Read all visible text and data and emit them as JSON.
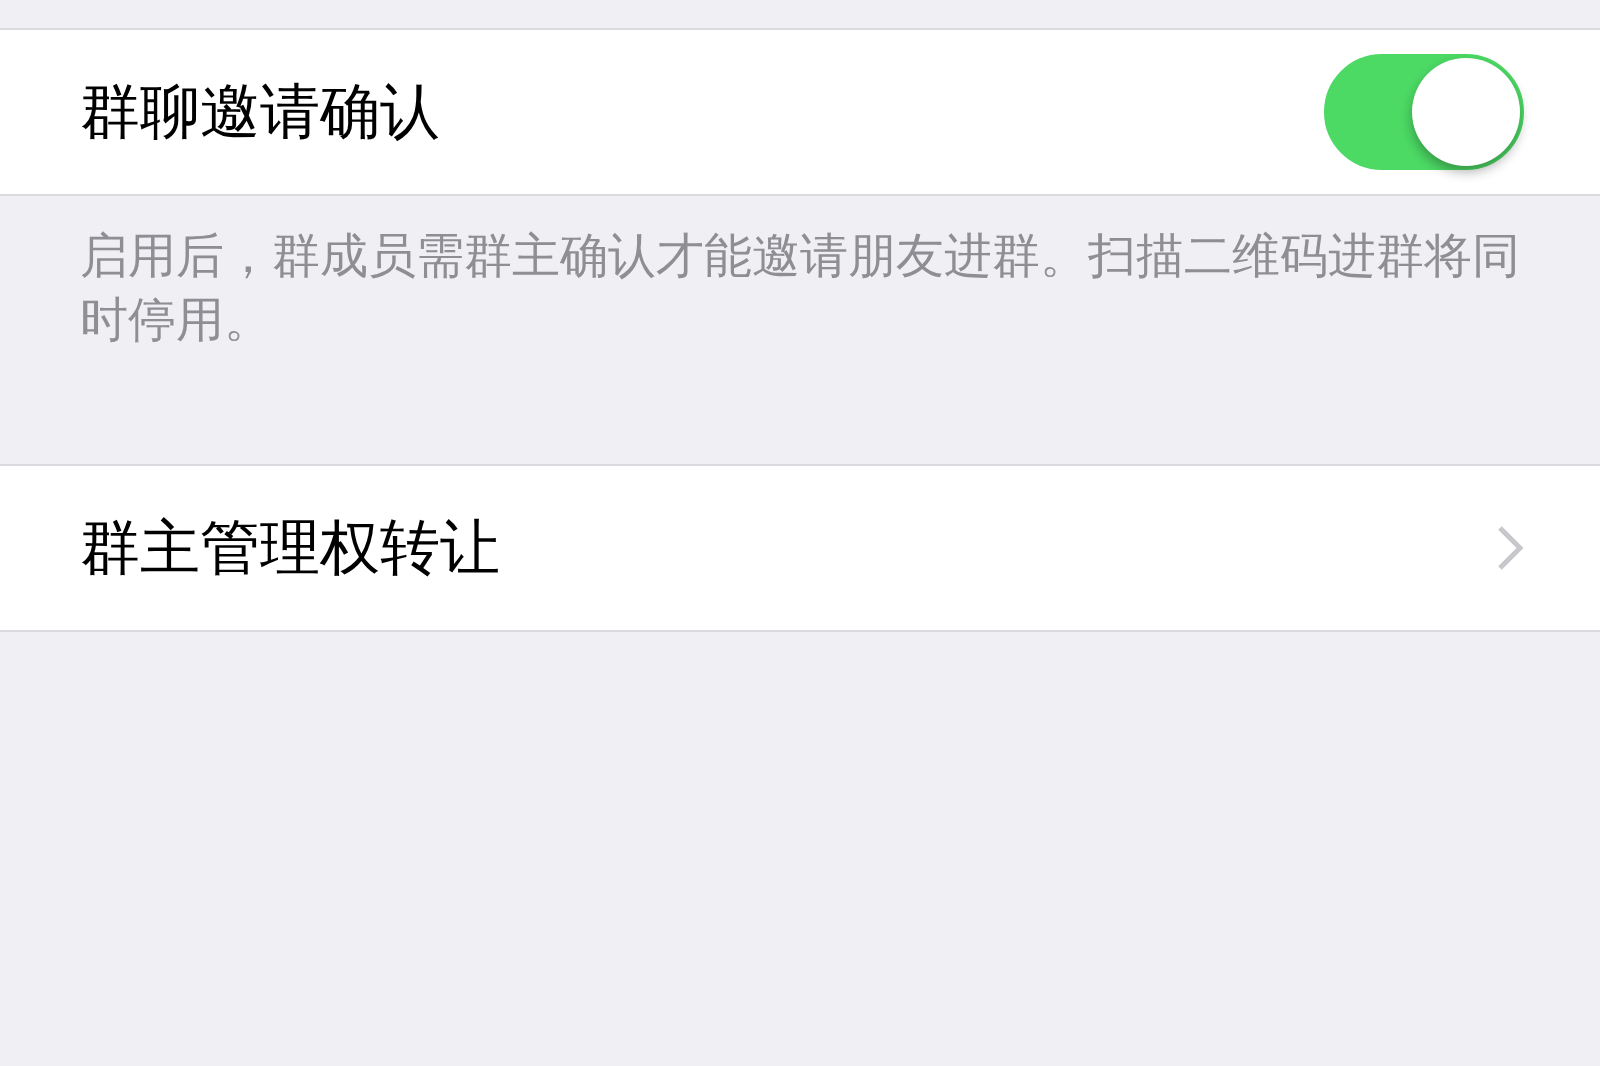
{
  "sections": [
    {
      "rows": [
        {
          "kind": "toggle",
          "label": "群聊邀请确认",
          "on": true
        }
      ],
      "footer": "启用后，群成员需群主确认才能邀请朋友进群。扫描二维码进群将同时停用。"
    },
    {
      "rows": [
        {
          "kind": "link",
          "label": "群主管理权转让"
        }
      ]
    }
  ]
}
